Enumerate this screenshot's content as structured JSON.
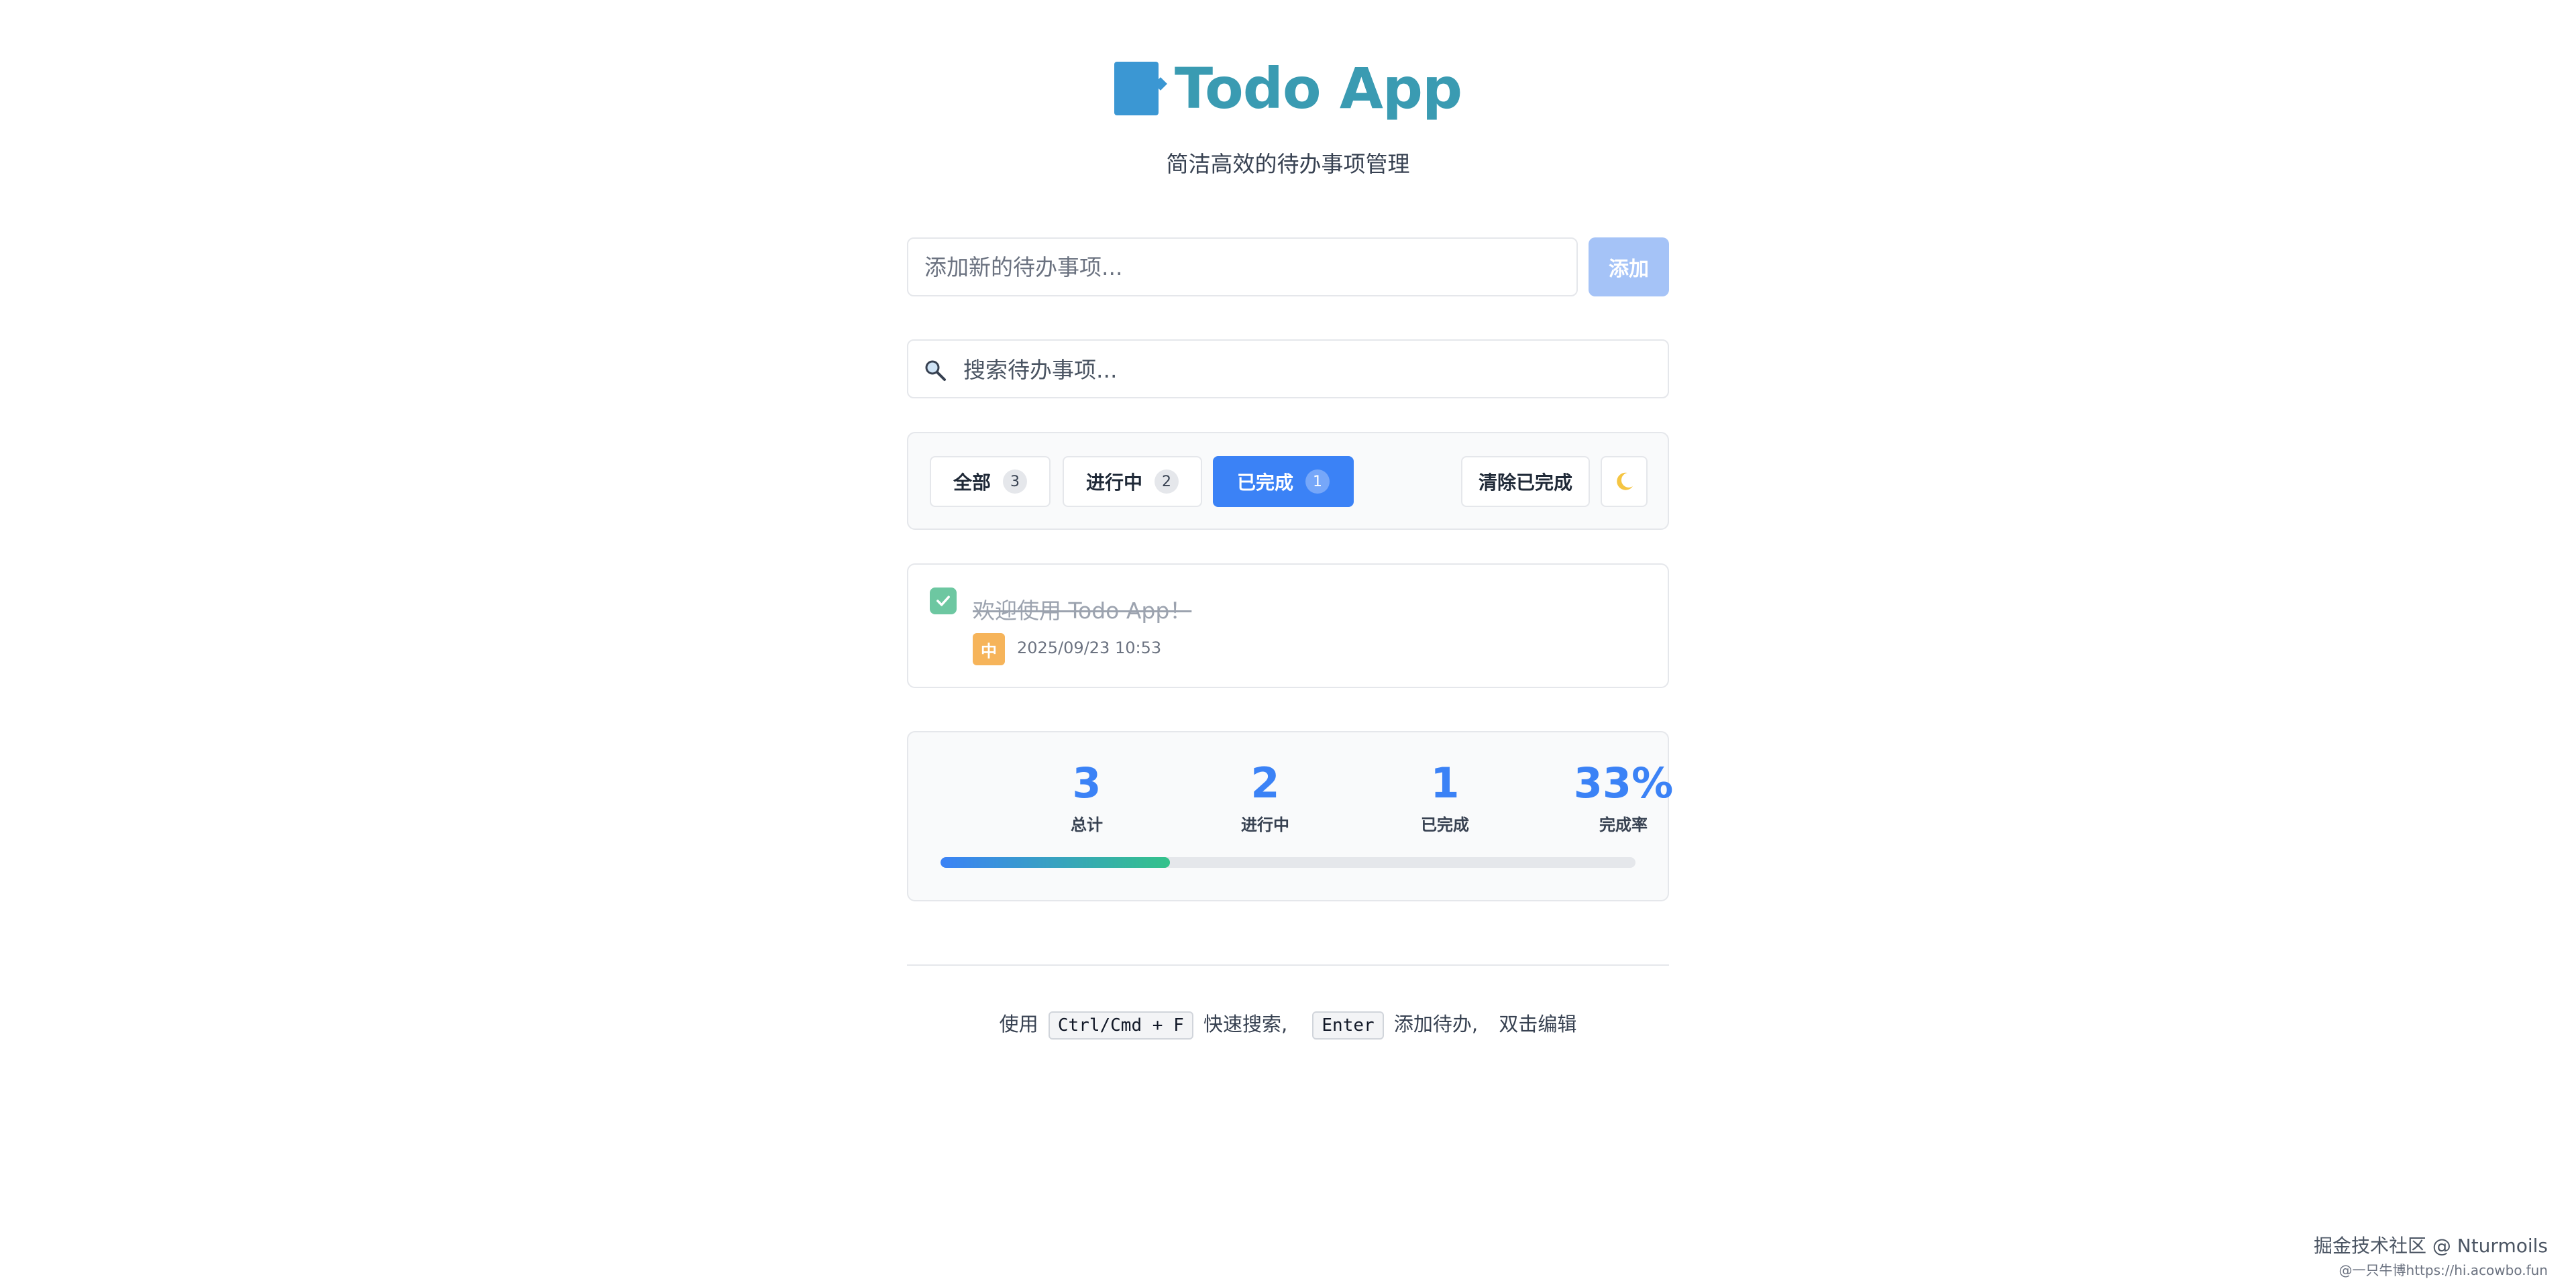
{
  "header": {
    "title": "Todo App",
    "subtitle": "简洁高效的待办事项管理",
    "logo_icon": "book-icon",
    "title_color": "#3a9bb2"
  },
  "add": {
    "placeholder": "添加新的待办事项...",
    "value": "",
    "button_label": "添加"
  },
  "search": {
    "placeholder": "搜索待办事项...",
    "value": "",
    "icon": "search-icon"
  },
  "filters": {
    "all_label": "全部",
    "all_count": "3",
    "active_label": "进行中",
    "active_count": "2",
    "done_label": "已完成",
    "done_count": "1",
    "selected": "已完成",
    "clear_label": "清除已完成",
    "theme_icon": "moon-icon"
  },
  "todos": [
    {
      "text": "欢迎使用 Todo App！",
      "completed": true,
      "priority": "中",
      "time": "2025/09/23 10:53"
    }
  ],
  "stats": {
    "total_value": "3",
    "total_label": "总计",
    "active_value": "2",
    "active_label": "进行中",
    "done_value": "1",
    "done_label": "已完成",
    "rate_value": "33%",
    "rate_label": "完成率",
    "progress_percent": 33
  },
  "hint": {
    "prefix": "使用",
    "key_search": "Ctrl/Cmd + F",
    "search_text": "快速搜索,",
    "key_add": "Enter",
    "add_text": "添加待办,",
    "edit_text": "双击编辑"
  },
  "watermark": {
    "line1": "掘金技术社区 @ Nturmoils",
    "line2": "@一只牛博https://hi.acowbo.fun"
  },
  "colors": {
    "accent": "#3b82f6",
    "success": "#6dc7a1",
    "priority_medium": "#f6b45a",
    "add_button_disabled": "#a5c3f7"
  }
}
